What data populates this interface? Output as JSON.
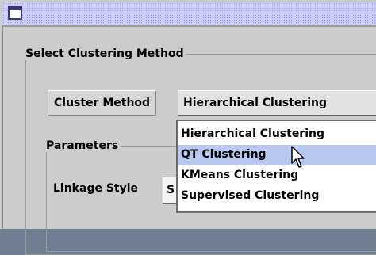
{
  "window": {
    "icon": "window-menu-icon"
  },
  "outer_group": {
    "legend": "Select Clustering Method"
  },
  "cluster_method": {
    "label": "Cluster Method",
    "selected": "Hierarchical Clustering",
    "options": [
      "Hierarchical Clustering",
      "QT Clustering",
      "KMeans Clustering",
      "Supervised Clustering"
    ],
    "highlighted_index": 1
  },
  "parameters": {
    "legend": "Parameters",
    "linkage_label": "Linkage Style",
    "linkage_value": "S"
  },
  "colors": {
    "highlight": "#b8c8f0",
    "titlebar": "#ccccff",
    "panel": "#cccccc"
  },
  "cursor": {
    "icon": "arrow-pointer-icon"
  }
}
